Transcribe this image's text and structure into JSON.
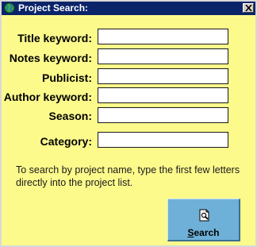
{
  "window": {
    "title": "Project Search:"
  },
  "icons": {
    "app": "globe-icon",
    "close": "close-icon",
    "search": "document-magnifier-icon"
  },
  "form": {
    "fields": [
      {
        "label": "Title keyword:",
        "value": ""
      },
      {
        "label": "Notes keyword:",
        "value": ""
      },
      {
        "label": "Publicist:",
        "value": ""
      },
      {
        "label": "Author keyword:",
        "value": ""
      },
      {
        "label": "Season:",
        "value": ""
      },
      {
        "label": "Category:",
        "value": ""
      }
    ],
    "hint": "To search by project name, type the first few letters directly into the project list."
  },
  "search_button": {
    "mnemonic": "S",
    "label_rest": "earch"
  },
  "colors": {
    "background": "#fdfa8c",
    "titlebar": "#0a246a",
    "button": "#6fb0d8"
  }
}
